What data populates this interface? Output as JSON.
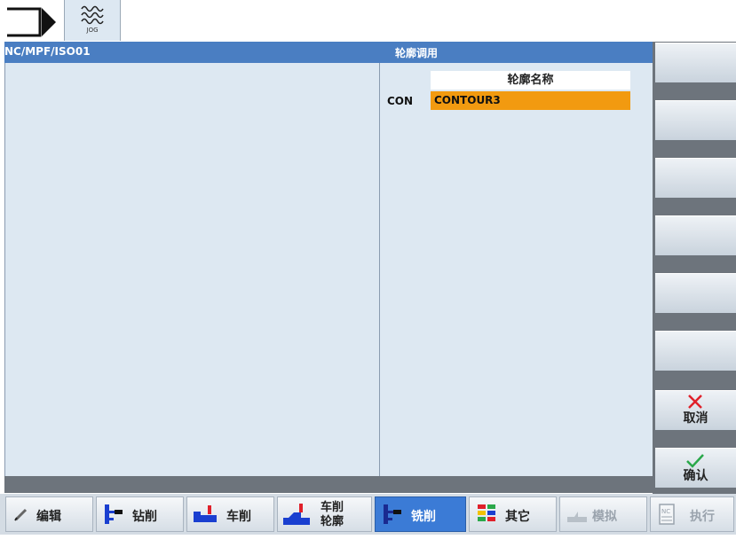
{
  "top": {
    "jog_label": "JOG"
  },
  "main": {
    "path": "NC/MPF/ISO01",
    "dialog_title": "轮廓调用",
    "contour_name_header": "轮廓名称",
    "con_label": "CON",
    "con_value": "CONTOUR3"
  },
  "vertical_softkeys": {
    "cancel_label": "取消",
    "confirm_label": "确认"
  },
  "horizontal_softkeys": {
    "edit": "编辑",
    "drilling": "钻削",
    "turning": "车削",
    "turning_contour_line1": "车削",
    "turning_contour_line2": "轮廓",
    "milling": "铣削",
    "other": "其它",
    "simulation": "模拟",
    "execute": "执行"
  },
  "colors": {
    "title_bar": "#4a7ec2",
    "panel_bg": "#dde8f2",
    "selected_field": "#f29a10",
    "active_softkey": "#3b7bd6"
  }
}
